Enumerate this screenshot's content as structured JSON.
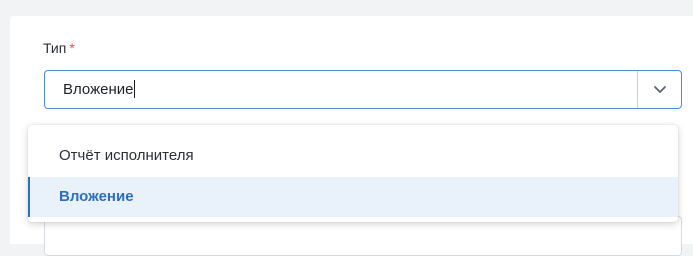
{
  "field": {
    "label": "Тип",
    "required_mark": "*",
    "value": "Вложение"
  },
  "dropdown": {
    "options": [
      {
        "label": "Отчёт исполнителя",
        "selected": false
      },
      {
        "label": "Вложение",
        "selected": true
      }
    ]
  },
  "icons": {
    "toggle": "chevron-down-icon"
  },
  "colors": {
    "accent": "#2c6fbf",
    "focus_border": "#4a8fd6",
    "required": "#e5534b",
    "selected_bg": "#e9f1fb"
  }
}
